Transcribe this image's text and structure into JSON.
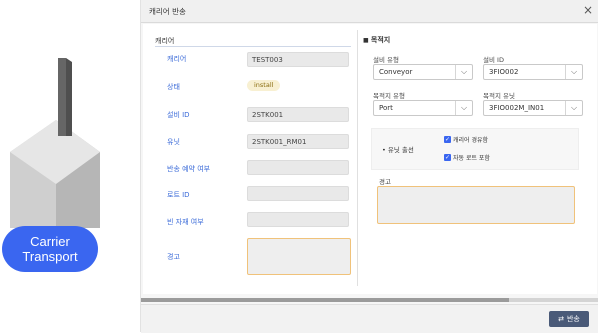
{
  "badge": {
    "line1": "Carrier",
    "line2": "Transport"
  },
  "dialog": {
    "title": "캐리어 반송",
    "close_glyph": "×"
  },
  "carrier_section": {
    "title": "캐리어",
    "fields": [
      {
        "label": "캐리어",
        "value": "TEST003"
      },
      {
        "label": "상태",
        "value": "install"
      },
      {
        "label": "설비 ID",
        "value": "2STK001"
      },
      {
        "label": "유닛",
        "value": "2STK001_RM01"
      },
      {
        "label": "반송 예약 여부",
        "value": ""
      },
      {
        "label": "로트 ID",
        "value": ""
      },
      {
        "label": "빈 자재 여부",
        "value": ""
      },
      {
        "label": "경고",
        "value": ""
      }
    ]
  },
  "dest_section": {
    "title": "목적지",
    "bullet": "■",
    "equip_type_label": "설비 유형",
    "equip_type_value": "Conveyor",
    "equip_id_label": "설비 ID",
    "equip_id_value": "3FIO002",
    "dest_type_label": "목적지 유형",
    "dest_type_value": "Port",
    "dest_unit_label": "목적지 유닛",
    "dest_unit_value": "3FIO002M_IN01",
    "unit_option_label": "• 유닛 출선",
    "check1": "캐리어 경유함",
    "check2": "자동 로트 포함",
    "warning_label": "경고",
    "chevron": "⌵"
  },
  "footer": {
    "transfer_button": "반송"
  },
  "colors": {
    "accent": "#3a66f0",
    "label": "#3a6ad8",
    "button": "#4a5a78",
    "warn_border": "#f0c27a"
  }
}
